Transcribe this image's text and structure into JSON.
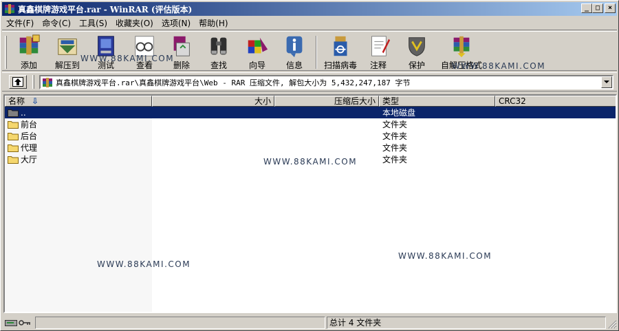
{
  "window": {
    "title": "真鑫棋牌游戏平台.rar - WinRAR (评估版本)",
    "minimize_glyph": "_",
    "maximize_glyph": "□",
    "close_glyph": "×"
  },
  "menu": [
    "文件(F)",
    "命令(C)",
    "工具(S)",
    "收藏夹(O)",
    "选项(N)",
    "帮助(H)"
  ],
  "toolbar": {
    "items": [
      {
        "label": "添加",
        "icon": "add-archive-icon"
      },
      {
        "label": "解压到",
        "icon": "extract-to-icon"
      },
      {
        "label": "测试",
        "icon": "test-icon"
      },
      {
        "label": "查看",
        "icon": "view-glasses-icon"
      },
      {
        "label": "删除",
        "icon": "delete-recycle-icon"
      },
      {
        "label": "查找",
        "icon": "find-binoculars-icon"
      },
      {
        "label": "向导",
        "icon": "wizard-icon"
      },
      {
        "label": "信息",
        "icon": "info-icon"
      },
      {
        "label": "扫描病毒",
        "icon": "virus-scan-icon"
      },
      {
        "label": "注释",
        "icon": "comment-icon"
      },
      {
        "label": "保护",
        "icon": "protect-shield-icon"
      },
      {
        "label": "自解压格式",
        "icon": "sfx-icon"
      }
    ]
  },
  "address": {
    "path": "真鑫棋牌游戏平台.rar\\真鑫棋牌游戏平台\\Web - RAR 压缩文件, 解包大小为 5,432,247,187 字节"
  },
  "list": {
    "columns": [
      "名称",
      "大小",
      "压缩后大小",
      "类型",
      "CRC32"
    ],
    "rows": [
      {
        "name": "..",
        "size": "",
        "packed": "",
        "type": "本地磁盘",
        "crc": "",
        "selected": true
      },
      {
        "name": "前台",
        "size": "",
        "packed": "",
        "type": "文件夹",
        "crc": "",
        "selected": false
      },
      {
        "name": "后台",
        "size": "",
        "packed": "",
        "type": "文件夹",
        "crc": "",
        "selected": false
      },
      {
        "name": "代理",
        "size": "",
        "packed": "",
        "type": "文件夹",
        "crc": "",
        "selected": false
      },
      {
        "name": "大厅",
        "size": "",
        "packed": "",
        "type": "文件夹",
        "crc": "",
        "selected": false
      }
    ]
  },
  "watermark": "WWW.88KAMI.COM",
  "status": {
    "left": "",
    "right": "总计 4 文件夹"
  },
  "colors": {
    "title_start": "#0a246a",
    "title_end": "#a6caf0",
    "selection": "#0a246a",
    "face": "#d4d0c8",
    "folder": "#f5d76e"
  }
}
